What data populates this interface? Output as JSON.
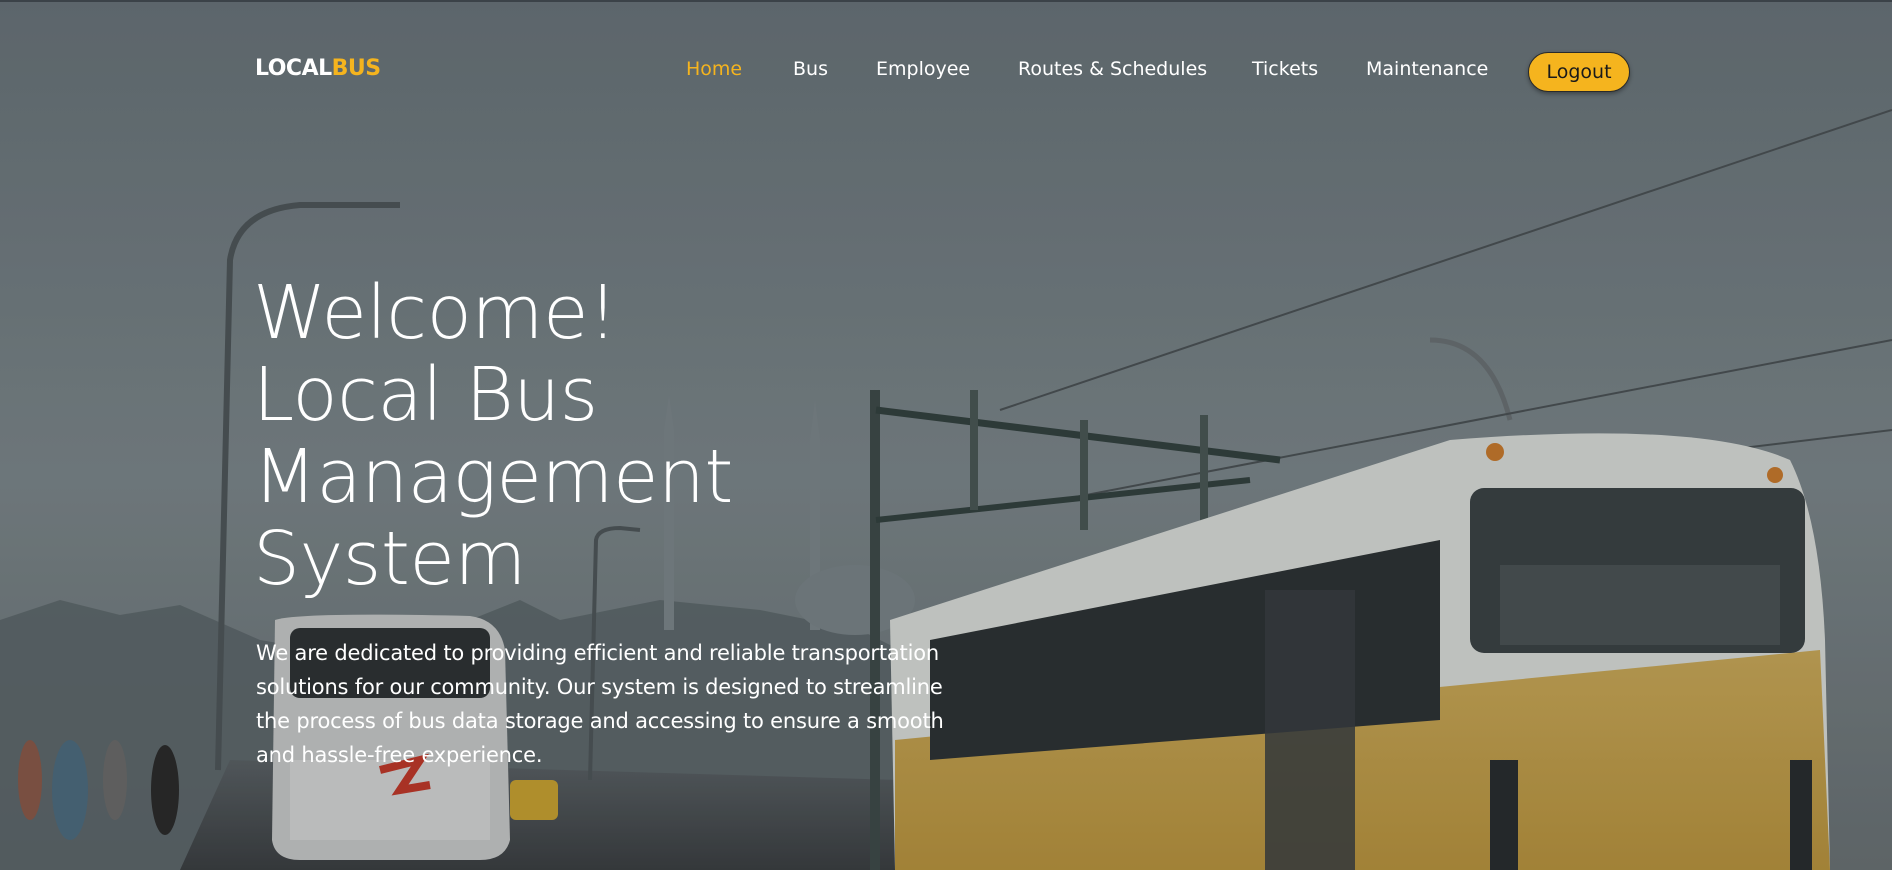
{
  "brand": {
    "logo_primary": "LOCAL",
    "logo_accent": "BUS"
  },
  "nav": {
    "items": [
      {
        "label": "Home",
        "active": true
      },
      {
        "label": "Bus",
        "active": false
      },
      {
        "label": "Employee",
        "active": false
      },
      {
        "label": "Routes & Schedules",
        "active": false
      },
      {
        "label": "Tickets",
        "active": false
      },
      {
        "label": "Maintenance",
        "active": false
      }
    ],
    "logout_label": "Logout"
  },
  "hero": {
    "title_lines": [
      "Welcome!",
      "Local Bus",
      "Management",
      "System"
    ],
    "description": "We are dedicated to providing efficient and reliable transportation solutions for our community. Our system is designed to streamline the process of bus data storage and accessing to ensure a smooth and hassle-free experience."
  },
  "colors": {
    "accent": "#f5b41e",
    "text": "#ffffff",
    "button_text": "#1a1a1a"
  }
}
